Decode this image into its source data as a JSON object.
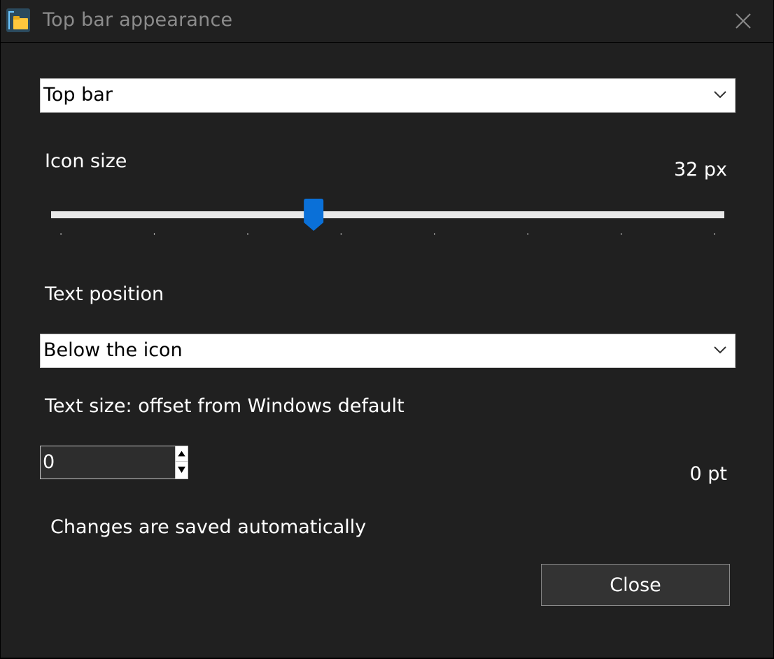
{
  "window": {
    "title": "Top bar appearance",
    "app_icon": "file-explorer-icon",
    "close_icon": "close-icon"
  },
  "bar_select": {
    "value": "Top bar"
  },
  "icon_size": {
    "label": "Icon size",
    "value_text": "32 px",
    "slider_fraction": 0.39,
    "tick_count": 8,
    "accent_color": "#0a70d8"
  },
  "text_position": {
    "label": "Text position",
    "value": "Below the icon"
  },
  "text_size": {
    "label": "Text size: offset from Windows default",
    "spin_value": "0",
    "value_text": "0 pt"
  },
  "footer": {
    "note": "Changes are saved automatically",
    "close_label": "Close"
  }
}
